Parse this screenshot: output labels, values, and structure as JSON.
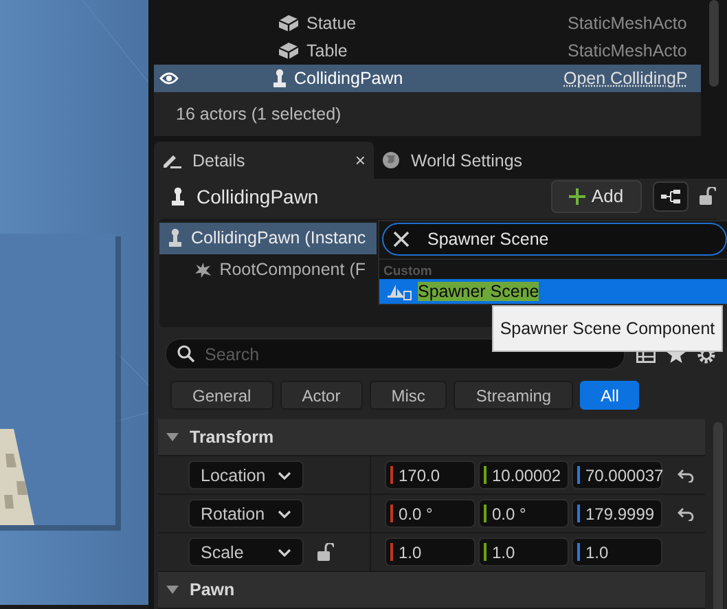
{
  "outliner": {
    "rows": [
      {
        "label": "Statue",
        "type": "StaticMeshActo",
        "kind": "mesh",
        "selected": false,
        "visible": false
      },
      {
        "label": "Table",
        "type": "StaticMeshActo",
        "kind": "mesh",
        "selected": false,
        "visible": false
      },
      {
        "label": "CollidingPawn",
        "type": "Open CollidingP",
        "kind": "pawn",
        "selected": true,
        "visible": true
      }
    ],
    "status": "16 actors (1 selected)"
  },
  "tabs": [
    {
      "label": "Details",
      "kind": "details",
      "selected": true,
      "close": "×"
    },
    {
      "label": "World Settings",
      "kind": "world",
      "selected": false
    }
  ],
  "details": {
    "title": "CollidingPawn",
    "add_button": "Add",
    "components": [
      {
        "label": "CollidingPawn (Instanc",
        "kind": "pawn",
        "selected": true
      },
      {
        "label": "RootComponent (F",
        "kind": "root",
        "selected": false
      }
    ],
    "search_placeholder": "Search",
    "filters": [
      {
        "label": "General",
        "selected": false
      },
      {
        "label": "Actor",
        "selected": false
      },
      {
        "label": "Misc",
        "selected": false
      },
      {
        "label": "Streaming",
        "selected": false
      },
      {
        "label": "All",
        "selected": true
      }
    ],
    "sections": [
      {
        "title": "Transform",
        "expanded": true,
        "rows": [
          {
            "label": "Location",
            "values": [
              "170.0",
              "10.00002",
              "70.000037"
            ],
            "reset": true,
            "lock": false
          },
          {
            "label": "Rotation",
            "values": [
              "0.0 °",
              "0.0 °",
              "179.9999"
            ],
            "reset": true,
            "lock": false
          },
          {
            "label": "Scale",
            "values": [
              "1.0",
              "1.0",
              "1.0"
            ],
            "reset": false,
            "lock": true
          }
        ]
      },
      {
        "title": "Pawn",
        "expanded": true
      }
    ]
  },
  "add_popup": {
    "query": "Spawner Scene",
    "category": "Custom",
    "items": [
      {
        "label": "Spawner Scene",
        "selected": true
      }
    ],
    "tooltip": "Spawner Scene Component"
  }
}
